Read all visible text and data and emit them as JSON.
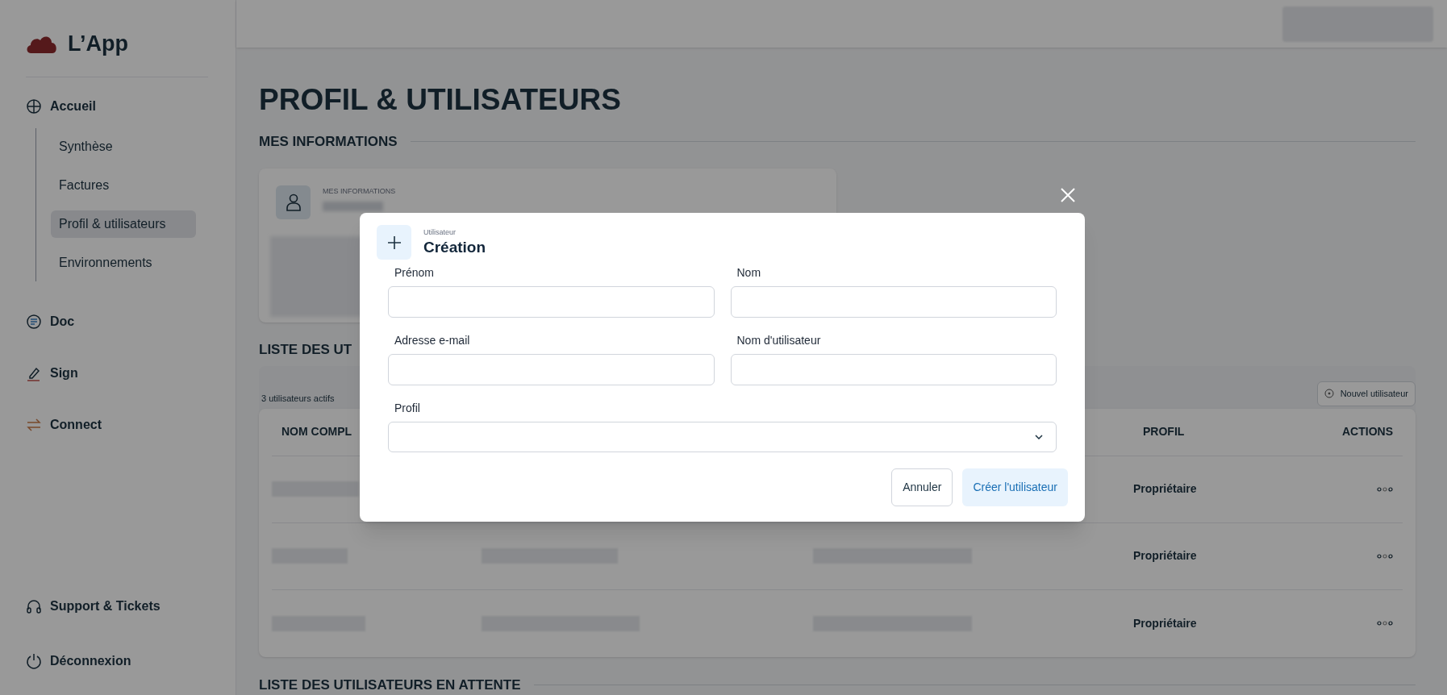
{
  "app": {
    "name": "L’App"
  },
  "sidebar": {
    "items": [
      {
        "label": "Accueil",
        "children": [
          {
            "label": "Synthèse",
            "selected": false
          },
          {
            "label": "Factures",
            "selected": false
          },
          {
            "label": "Profil & utilisateurs",
            "selected": true
          },
          {
            "label": "Environnements",
            "selected": false
          }
        ]
      },
      {
        "label": "Doc"
      },
      {
        "label": "Sign"
      },
      {
        "label": "Connect"
      }
    ],
    "footer": [
      {
        "label": "Support & Tickets"
      },
      {
        "label": "Déconnexion"
      }
    ]
  },
  "page": {
    "title": "PROFIL & UTILISATEURS",
    "info_section": {
      "heading": "MES INFORMATIONS",
      "card_label": "MES INFORMATIONS"
    },
    "users_section": {
      "heading": "LISTE DES UT",
      "count": "3 utilisateurs actifs",
      "new_button": "Nouvel utilisateur",
      "columns": [
        "NOM COMPL",
        "PROFIL",
        "ACTIONS"
      ],
      "rows": [
        {
          "profile": "Propriétaire"
        },
        {
          "profile": "Propriétaire"
        },
        {
          "profile": "Propriétaire"
        }
      ]
    },
    "pending_section": {
      "heading": "LISTE DES UTILISATEURS EN ATTENTE"
    }
  },
  "modal": {
    "subtitle": "Utilisateur",
    "title": "Création",
    "fields": [
      {
        "label": "Prénom",
        "kind": "text"
      },
      {
        "label": "Nom",
        "kind": "text"
      },
      {
        "label": "Adresse e-mail",
        "kind": "text"
      },
      {
        "label": "Nom d'utilisateur",
        "kind": "text"
      },
      {
        "label": "Profil",
        "kind": "select"
      }
    ],
    "buttons": [
      {
        "label": "Annuler",
        "kind": "secondary"
      },
      {
        "label": "Créer l'utilisateur",
        "kind": "primary"
      }
    ]
  }
}
